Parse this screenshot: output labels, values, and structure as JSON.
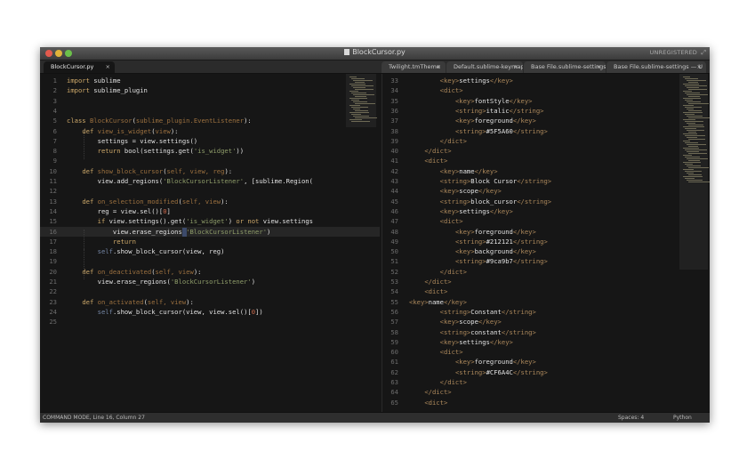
{
  "window": {
    "title": "BlockCursor.py",
    "unregistered": "UNREGISTERED",
    "traffic_lights": {
      "close": "#e25a4d",
      "minimize": "#e0b33a",
      "zoom": "#6cc04a"
    }
  },
  "tabs": [
    {
      "label": "BlockCursor.py",
      "active": true
    },
    {
      "label": "Twilight.tmTheme",
      "active": false
    },
    {
      "label": "Default.sublime-keymap",
      "active": false
    },
    {
      "label": "Base File.sublime-settings — D",
      "active": false
    },
    {
      "label": "Base File.sublime-settings — U",
      "active": false
    }
  ],
  "left_pane": {
    "line_numbers": [
      "1",
      "2",
      "3",
      "4",
      "5",
      "6",
      "7",
      "8",
      "9",
      "10",
      "11",
      "12",
      "13",
      "14",
      "15",
      "16",
      "17",
      "18",
      "19",
      "20",
      "21",
      "22",
      "23",
      "24",
      "25"
    ],
    "lines": [
      [
        [
          "kw",
          "import"
        ],
        [
          "",
          "sublime"
        ]
      ],
      [
        [
          "kw",
          "import"
        ],
        [
          "",
          "sublime_plugin"
        ]
      ],
      [],
      [],
      [
        [
          "kw",
          "class"
        ],
        [
          "",
          ""
        ],
        [
          "fn",
          "BlockCursor"
        ],
        [
          "",
          "("
        ],
        [
          "fn",
          "sublime_plugin.EventListener"
        ],
        [
          "",
          "):"
        ]
      ],
      [
        [
          "",
          "    "
        ],
        [
          "kw",
          "def"
        ],
        [
          "",
          ""
        ],
        [
          "fn",
          "view_is_widget"
        ],
        [
          "",
          "("
        ],
        [
          "fn",
          "view"
        ],
        [
          "",
          "):"
        ]
      ],
      [
        [
          "",
          "        settings = view.settings()"
        ]
      ],
      [
        [
          "",
          "        "
        ],
        [
          "kw",
          "return"
        ],
        [
          "",
          ""
        ],
        [
          "",
          "bool(settings.get("
        ],
        [
          "st",
          "'is_widget'"
        ],
        [
          "",
          "))"
        ]
      ],
      [],
      [
        [
          "",
          "    "
        ],
        [
          "kw",
          "def"
        ],
        [
          "",
          ""
        ],
        [
          "fn",
          "show_block_cursor"
        ],
        [
          "",
          "("
        ],
        [
          "fn",
          "self, view, reg"
        ],
        [
          "",
          "):"
        ]
      ],
      [
        [
          "",
          "        view.add_regions("
        ],
        [
          "st",
          "'BlockCursorListener'"
        ],
        [
          "",
          ", [sublime.Region("
        ]
      ],
      [],
      [
        [
          "",
          "    "
        ],
        [
          "kw",
          "def"
        ],
        [
          "",
          ""
        ],
        [
          "fn",
          "on_selection_modified"
        ],
        [
          "",
          "("
        ],
        [
          "fn",
          "self, view"
        ],
        [
          "",
          "):"
        ]
      ],
      [
        [
          "",
          "        reg = view.sel()["
        ],
        [
          "nm",
          "0"
        ],
        [
          "",
          "]"
        ]
      ],
      [
        [
          "",
          "        "
        ],
        [
          "kw",
          "if"
        ],
        [
          "",
          "view.settings().get("
        ],
        [
          "st",
          "'is_widget'"
        ],
        [
          "",
          ") "
        ],
        [
          "kw",
          "or not"
        ],
        [
          "",
          "view.settings"
        ]
      ],
      [
        [
          "",
          "            view.erase_regions("
        ],
        [
          "st",
          "'BlockCursorListener'"
        ],
        [
          "",
          ")"
        ]
      ],
      [
        [
          "",
          "            "
        ],
        [
          "kw",
          "return"
        ]
      ],
      [
        [
          "",
          "        "
        ],
        [
          "self",
          "self"
        ],
        [
          "",
          ".show_block_cursor(view, reg)"
        ]
      ],
      [],
      [
        [
          "",
          "    "
        ],
        [
          "kw",
          "def"
        ],
        [
          "",
          ""
        ],
        [
          "fn",
          "on_deactivated"
        ],
        [
          "",
          "("
        ],
        [
          "fn",
          "self, view"
        ],
        [
          "",
          "):"
        ]
      ],
      [
        [
          "",
          "        view.erase_regions("
        ],
        [
          "st",
          "'BlockCursorListener'"
        ],
        [
          "",
          ")"
        ]
      ],
      [],
      [
        [
          "",
          "    "
        ],
        [
          "kw",
          "def"
        ],
        [
          "",
          ""
        ],
        [
          "fn",
          "on_activated"
        ],
        [
          "",
          "("
        ],
        [
          "fn",
          "self, view"
        ],
        [
          "",
          "):"
        ]
      ],
      [
        [
          "",
          "        "
        ],
        [
          "self",
          "self"
        ],
        [
          "",
          ".show_block_cursor(view, view.sel()["
        ],
        [
          "nm",
          "0"
        ],
        [
          "",
          "])"
        ]
      ],
      []
    ]
  },
  "right_pane": {
    "line_numbers": [
      "33",
      "34",
      "35",
      "36",
      "37",
      "38",
      "39",
      "40",
      "41",
      "42",
      "43",
      "44",
      "45",
      "46",
      "47",
      "48",
      "49",
      "50",
      "51",
      "52",
      "53",
      "54",
      "55",
      "56",
      "57",
      "58",
      "59",
      "60",
      "61",
      "62",
      "63",
      "64",
      "65"
    ],
    "lines": [
      [
        [
          "",
          "        "
        ],
        [
          "tag",
          "<key>"
        ],
        [
          "ctn",
          "settings"
        ],
        [
          "tag",
          "</key>"
        ]
      ],
      [
        [
          "",
          "        "
        ],
        [
          "tag",
          "<dict>"
        ]
      ],
      [
        [
          "",
          "            "
        ],
        [
          "tag",
          "<key>"
        ],
        [
          "ctn",
          "fontStyle"
        ],
        [
          "tag",
          "</key>"
        ]
      ],
      [
        [
          "",
          "            "
        ],
        [
          "tag",
          "<string>"
        ],
        [
          "ctn",
          "italic"
        ],
        [
          "tag",
          "</string>"
        ]
      ],
      [
        [
          "",
          "            "
        ],
        [
          "tag",
          "<key>"
        ],
        [
          "ctn",
          "foreground"
        ],
        [
          "tag",
          "</key>"
        ]
      ],
      [
        [
          "",
          "            "
        ],
        [
          "tag",
          "<string>"
        ],
        [
          "ctn",
          "#5F5A60"
        ],
        [
          "tag",
          "</string>"
        ]
      ],
      [
        [
          "",
          "        "
        ],
        [
          "tag",
          "</dict>"
        ]
      ],
      [
        [
          "",
          "    "
        ],
        [
          "tag",
          "</dict>"
        ]
      ],
      [
        [
          "",
          "    "
        ],
        [
          "tag",
          "<dict>"
        ]
      ],
      [
        [
          "",
          "        "
        ],
        [
          "tag",
          "<key>"
        ],
        [
          "ctn",
          "name"
        ],
        [
          "tag",
          "</key>"
        ]
      ],
      [
        [
          "",
          "        "
        ],
        [
          "tag",
          "<string>"
        ],
        [
          "ctn",
          "Block Cursor"
        ],
        [
          "tag",
          "</string>"
        ]
      ],
      [
        [
          "",
          "        "
        ],
        [
          "tag",
          "<key>"
        ],
        [
          "ctn",
          "scope"
        ],
        [
          "tag",
          "</key>"
        ]
      ],
      [
        [
          "",
          "        "
        ],
        [
          "tag",
          "<string>"
        ],
        [
          "ctn",
          "block_cursor"
        ],
        [
          "tag",
          "</string>"
        ]
      ],
      [
        [
          "",
          "        "
        ],
        [
          "tag",
          "<key>"
        ],
        [
          "ctn",
          "settings"
        ],
        [
          "tag",
          "</key>"
        ]
      ],
      [
        [
          "",
          "        "
        ],
        [
          "tag",
          "<dict>"
        ]
      ],
      [
        [
          "",
          "            "
        ],
        [
          "tag",
          "<key>"
        ],
        [
          "ctn",
          "foreground"
        ],
        [
          "tag",
          "</key>"
        ]
      ],
      [
        [
          "",
          "            "
        ],
        [
          "tag",
          "<string>"
        ],
        [
          "ctn",
          "#212121"
        ],
        [
          "tag",
          "</string>"
        ]
      ],
      [
        [
          "",
          "            "
        ],
        [
          "tag",
          "<key>"
        ],
        [
          "ctn",
          "background"
        ],
        [
          "tag",
          "</key>"
        ]
      ],
      [
        [
          "",
          "            "
        ],
        [
          "tag",
          "<string>"
        ],
        [
          "ctn",
          "#9ca9b7"
        ],
        [
          "tag",
          "</string>"
        ]
      ],
      [
        [
          "",
          "        "
        ],
        [
          "tag",
          "</dict>"
        ]
      ],
      [
        [
          "",
          "    "
        ],
        [
          "tag",
          "</dict>"
        ]
      ],
      [
        [
          "",
          "    "
        ],
        [
          "tag",
          "<dict>"
        ]
      ],
      [
        [
          "",
          ""
        ],
        [
          "tag",
          "<key>"
        ],
        [
          "ctn",
          "name"
        ],
        [
          "tag",
          "</key>"
        ]
      ],
      [
        [
          "",
          "        "
        ],
        [
          "tag",
          "<string>"
        ],
        [
          "ctn",
          "Constant"
        ],
        [
          "tag",
          "</string>"
        ]
      ],
      [
        [
          "",
          "        "
        ],
        [
          "tag",
          "<key>"
        ],
        [
          "ctn",
          "scope"
        ],
        [
          "tag",
          "</key>"
        ]
      ],
      [
        [
          "",
          "        "
        ],
        [
          "tag",
          "<string>"
        ],
        [
          "ctn",
          "constant"
        ],
        [
          "tag",
          "</string>"
        ]
      ],
      [
        [
          "",
          "        "
        ],
        [
          "tag",
          "<key>"
        ],
        [
          "ctn",
          "settings"
        ],
        [
          "tag",
          "</key>"
        ]
      ],
      [
        [
          "",
          "        "
        ],
        [
          "tag",
          "<dict>"
        ]
      ],
      [
        [
          "",
          "            "
        ],
        [
          "tag",
          "<key>"
        ],
        [
          "ctn",
          "foreground"
        ],
        [
          "tag",
          "</key>"
        ]
      ],
      [
        [
          "",
          "            "
        ],
        [
          "tag",
          "<string>"
        ],
        [
          "ctn",
          "#CF6A4C"
        ],
        [
          "tag",
          "</string>"
        ]
      ],
      [
        [
          "",
          "        "
        ],
        [
          "tag",
          "</dict>"
        ]
      ],
      [
        [
          "",
          "    "
        ],
        [
          "tag",
          "</dict>"
        ]
      ],
      [
        [
          "",
          "    "
        ],
        [
          "tag",
          "<dict>"
        ]
      ]
    ]
  },
  "status_bar": {
    "mode": "COMMAND MODE, Line 16, Column 27",
    "spaces": "Spaces: 4",
    "syntax": "Python"
  },
  "colors": {
    "background": "#161616",
    "keyword": "#cda869",
    "function": "#9b703f",
    "string": "#8f9d6a",
    "number": "#cf6a4c",
    "tag": "#ac885b"
  }
}
